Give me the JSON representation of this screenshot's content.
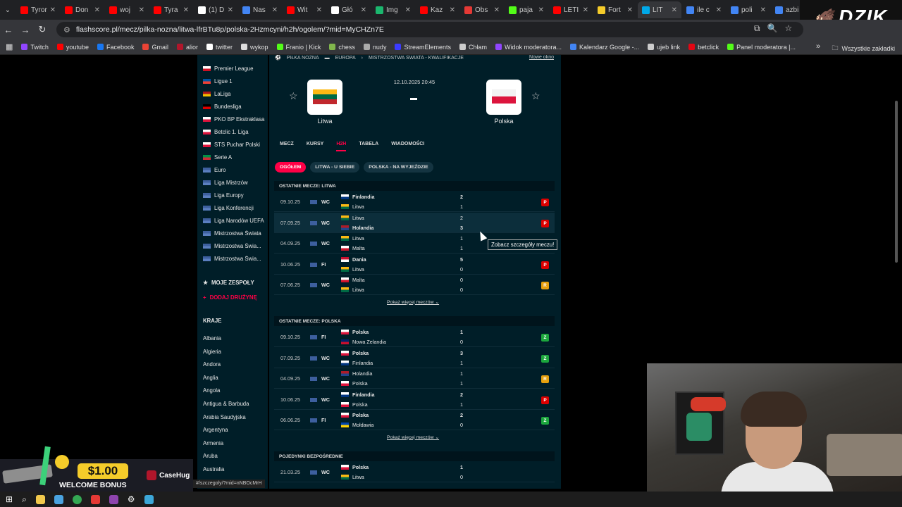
{
  "browser": {
    "tabs": [
      {
        "title": "Tyrone",
        "color": "#ff0000"
      },
      {
        "title": "Don",
        "color": "#ff0000"
      },
      {
        "title": "woj",
        "color": "#ff0000"
      },
      {
        "title": "Tyra",
        "color": "#ff0000"
      },
      {
        "title": "(1) D",
        "color": "#ffffff"
      },
      {
        "title": "Nas",
        "color": "#4285f4"
      },
      {
        "title": "Wit",
        "color": "#ff0000"
      },
      {
        "title": "Głó",
        "color": "#ffffff"
      },
      {
        "title": "Img",
        "color": "#1bb76e"
      },
      {
        "title": "Kaz",
        "color": "#ff0000"
      },
      {
        "title": "Obs",
        "color": "#e53935"
      },
      {
        "title": "paja",
        "color": "#53fc18"
      },
      {
        "title": "LETI",
        "color": "#ff0000"
      },
      {
        "title": "Fort",
        "color": "#f5cc2a"
      },
      {
        "title": "LIT",
        "color": "#00a8e8",
        "active": true
      },
      {
        "title": "ile c",
        "color": "#4285f4"
      },
      {
        "title": "poli",
        "color": "#4285f4"
      },
      {
        "title": "azbi",
        "color": "#4285f4"
      }
    ],
    "url": "flashscore.pl/mecz/pilka-nozna/litwa-lfrBTu8p/polska-2Hzmcyni/h2h/ogolem/?mid=MyCHZn7E",
    "bookmarks": [
      {
        "label": "Twitch",
        "color": "#9146ff"
      },
      {
        "label": "youtube",
        "color": "#ff0000"
      },
      {
        "label": "Facebook",
        "color": "#1877f2"
      },
      {
        "label": "Gmail",
        "color": "#ea4335"
      },
      {
        "label": "alior",
        "color": "#b1162b"
      },
      {
        "label": "twitter",
        "color": "#ffffff"
      },
      {
        "label": "wykop",
        "color": "#dddddd"
      },
      {
        "label": "Franio | Kick",
        "color": "#53fc18"
      },
      {
        "label": "chess",
        "color": "#81b64c"
      },
      {
        "label": "nudy",
        "color": "#aaaaaa"
      },
      {
        "label": "StreamElements",
        "color": "#3b3bff"
      },
      {
        "label": "Chłam",
        "color": "#cccccc"
      },
      {
        "label": "Widok moderatora...",
        "color": "#9146ff"
      },
      {
        "label": "Kalendarz Google -...",
        "color": "#4285f4"
      },
      {
        "label": "ujeb link",
        "color": "#cccccc"
      },
      {
        "label": "betclick",
        "color": "#e30613"
      },
      {
        "label": "Panel moderatora |...",
        "color": "#53fc18"
      }
    ],
    "all_bookmarks": "Wszystkie zakładki",
    "channel_logo": "DZIK"
  },
  "sidebar": {
    "leagues": [
      {
        "label": "Premier League",
        "flag": "eng"
      },
      {
        "label": "Ligue 1",
        "flag": "fr"
      },
      {
        "label": "LaLiga",
        "flag": "es"
      },
      {
        "label": "Bundesliga",
        "flag": "de"
      },
      {
        "label": "PKO BP Ekstraklasa",
        "flag": "pl"
      },
      {
        "label": "Betclic 1. Liga",
        "flag": "pl"
      },
      {
        "label": "STS Puchar Polski",
        "flag": "pl"
      },
      {
        "label": "Serie A",
        "flag": "it"
      },
      {
        "label": "Euro",
        "flag": "eu"
      },
      {
        "label": "Liga Mistrzów",
        "flag": "eu"
      },
      {
        "label": "Liga Europy",
        "flag": "eu"
      },
      {
        "label": "Liga Konferencji",
        "flag": "eu"
      },
      {
        "label": "Liga Narodów UEFA",
        "flag": "eu"
      },
      {
        "label": "Mistrzostwa Świata",
        "flag": "eu"
      },
      {
        "label": "Mistrzostwa Świa...",
        "flag": "eu"
      },
      {
        "label": "Mistrzostwa Świa...",
        "flag": "eu"
      }
    ],
    "my_teams": "MOJE ZESPOŁY",
    "add_team": "DODAJ DRUŻYNĘ",
    "countries_head": "KRAJE",
    "countries": [
      "Albania",
      "Algieria",
      "Andora",
      "Anglia",
      "Angola",
      "Antigua & Barbuda",
      "Arabia Saudyjska",
      "Argentyna",
      "Armenia",
      "Aruba",
      "Australia"
    ]
  },
  "match": {
    "breadcrumb": [
      "PIŁKA NOŻNA",
      "EUROPA",
      "MISTRZOSTWA ŚWIATA - KWALIFIKACJE"
    ],
    "new_window": "Nowe okno",
    "date": "12.10.2025 20:45",
    "home": "Litwa",
    "away": "Polska",
    "score_placeholder": "-",
    "tabs": [
      "MECZ",
      "KURSY",
      "H2H",
      "TABELA",
      "WIADOMOŚCI"
    ],
    "active_tab": "H2H",
    "filters": [
      "OGÓŁEM",
      "LITWA - U SIEBIE",
      "POLSKA - NA WYJEŹDZIE"
    ]
  },
  "sections": [
    {
      "title": "OSTATNIE MECZE: LITWA",
      "rows": [
        {
          "date": "09.10.25",
          "comp": "WC",
          "t1": "Finlandia",
          "f1": "fi",
          "s1": "2",
          "t2": "Litwa",
          "f2": "lt",
          "s2": "1",
          "bold": 1,
          "badge": "P"
        },
        {
          "date": "07.09.25",
          "comp": "WC",
          "t1": "Litwa",
          "f1": "lt",
          "s1": "2",
          "t2": "Holandia",
          "f2": "nl",
          "s2": "3",
          "bold": 2,
          "badge": "P"
        },
        {
          "date": "04.09.25",
          "comp": "WC",
          "t1": "Litwa",
          "f1": "lt",
          "s1": "1",
          "t2": "Malta",
          "f2": "mt",
          "s2": "1",
          "bold": 0,
          "badge": ""
        },
        {
          "date": "10.06.25",
          "comp": "FI",
          "t1": "Dania",
          "f1": "dk",
          "s1": "5",
          "t2": "Litwa",
          "f2": "lt",
          "s2": "0",
          "bold": 1,
          "badge": "P"
        },
        {
          "date": "07.06.25",
          "comp": "WC",
          "t1": "Malta",
          "f1": "mt",
          "s1": "0",
          "t2": "Litwa",
          "f2": "lt",
          "s2": "0",
          "bold": 0,
          "badge": "R"
        }
      ],
      "more": "Pokaż więcej meczów"
    },
    {
      "title": "OSTATNIE MECZE: POLSKA",
      "rows": [
        {
          "date": "09.10.25",
          "comp": "FI",
          "t1": "Polska",
          "f1": "pl",
          "s1": "1",
          "t2": "Nowa Zelandia",
          "f2": "nz",
          "s2": "0",
          "bold": 1,
          "badge": "Z"
        },
        {
          "date": "07.09.25",
          "comp": "WC",
          "t1": "Polska",
          "f1": "pl",
          "s1": "3",
          "t2": "Finlandia",
          "f2": "fi",
          "s2": "1",
          "bold": 1,
          "badge": "Z"
        },
        {
          "date": "04.09.25",
          "comp": "WC",
          "t1": "Holandia",
          "f1": "nl",
          "s1": "1",
          "t2": "Polska",
          "f2": "pl",
          "s2": "1",
          "bold": 0,
          "badge": "R"
        },
        {
          "date": "10.06.25",
          "comp": "WC",
          "t1": "Finlandia",
          "f1": "fi",
          "s1": "2",
          "t2": "Polska",
          "f2": "pl",
          "s2": "1",
          "bold": 1,
          "badge": "P"
        },
        {
          "date": "06.06.25",
          "comp": "FI",
          "t1": "Polska",
          "f1": "pl",
          "s1": "2",
          "t2": "Mołdawia",
          "f2": "md",
          "s2": "0",
          "bold": 1,
          "badge": "Z"
        }
      ],
      "more": "Pokaż więcej meczów"
    },
    {
      "title": "POJEDYNKI BEZPOŚREDNIE",
      "rows": [
        {
          "date": "21.03.25",
          "comp": "WC",
          "t1": "Polska",
          "f1": "pl",
          "s1": "1",
          "t2": "Litwa",
          "f2": "lt",
          "s2": "0",
          "bold": 1,
          "badge": ""
        }
      ]
    }
  ],
  "tooltip": "Zobacz szczegóły meczu!",
  "status_url": "#/szczegoly/?mid=nNBOcMrH",
  "ad": {
    "amount": "$1.00",
    "text": "WELCOME BONUS",
    "brand": "CaseHug"
  },
  "colors": {
    "accent": "#ff0046",
    "bg": "#001e28",
    "win": "#1ca73d",
    "loss": "#dc0000",
    "draw": "#e5a00d"
  }
}
